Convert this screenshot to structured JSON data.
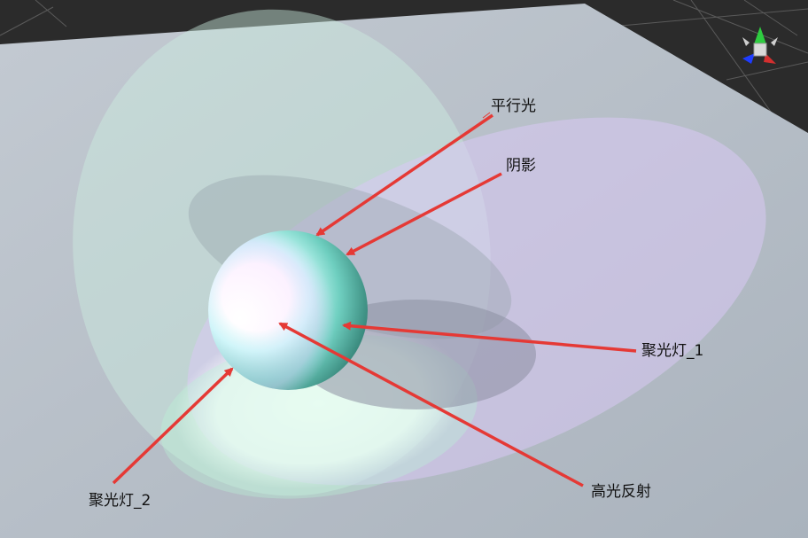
{
  "scene": {
    "background_color": "#2b2b2b",
    "ground_color": "#b7bfc8",
    "sphere_colors": [
      "#ffffff",
      "#7fe8d8",
      "#3b8f83"
    ],
    "spotlight_1_color": "#d7c7f2",
    "spotlight_2_color": "#c4f2da",
    "arrow_color": "#e53935"
  },
  "annotations": {
    "directional_light": "平行光",
    "shadow": "阴影",
    "spotlight_1": "聚光灯_1",
    "spotlight_2": "聚光灯_2",
    "specular_highlight": "高光反射"
  },
  "gizmo": {
    "axes": [
      "y-axis",
      "x-axis",
      "z-axis"
    ],
    "axis_colors": {
      "x": "#d32f2f",
      "y": "#2ecc40",
      "z": "#1e3cff"
    }
  }
}
